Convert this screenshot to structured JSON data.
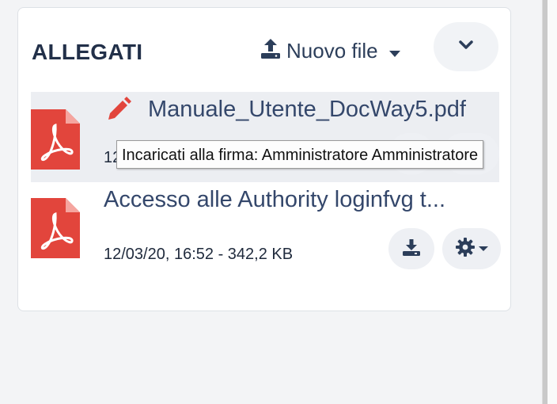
{
  "panel": {
    "title": "ALLEGATI",
    "new_file_label": "Nuovo file",
    "icons": {
      "upload": "upload-icon",
      "caret": "caret-down-icon",
      "collapse": "chevron-down-icon"
    }
  },
  "files": [
    {
      "name": "Manuale_Utente_DocWay5.pdf",
      "meta": "12",
      "icon": "pdf-file-icon",
      "signature_icon": "pencil-icon",
      "accent": "#e2453c"
    },
    {
      "name": "Accesso alle Authority loginfvg t...",
      "meta": "12/03/20, 16:52 - 342,2 KB",
      "icon": "pdf-file-icon",
      "accent": "#e2453c"
    }
  ],
  "tooltip": {
    "text": "Incaricati alla firma: Amministratore Amministratore"
  },
  "colors": {
    "accent": "#e2453c",
    "text": "#2c3e5a",
    "button_bg": "#eef0f4"
  }
}
